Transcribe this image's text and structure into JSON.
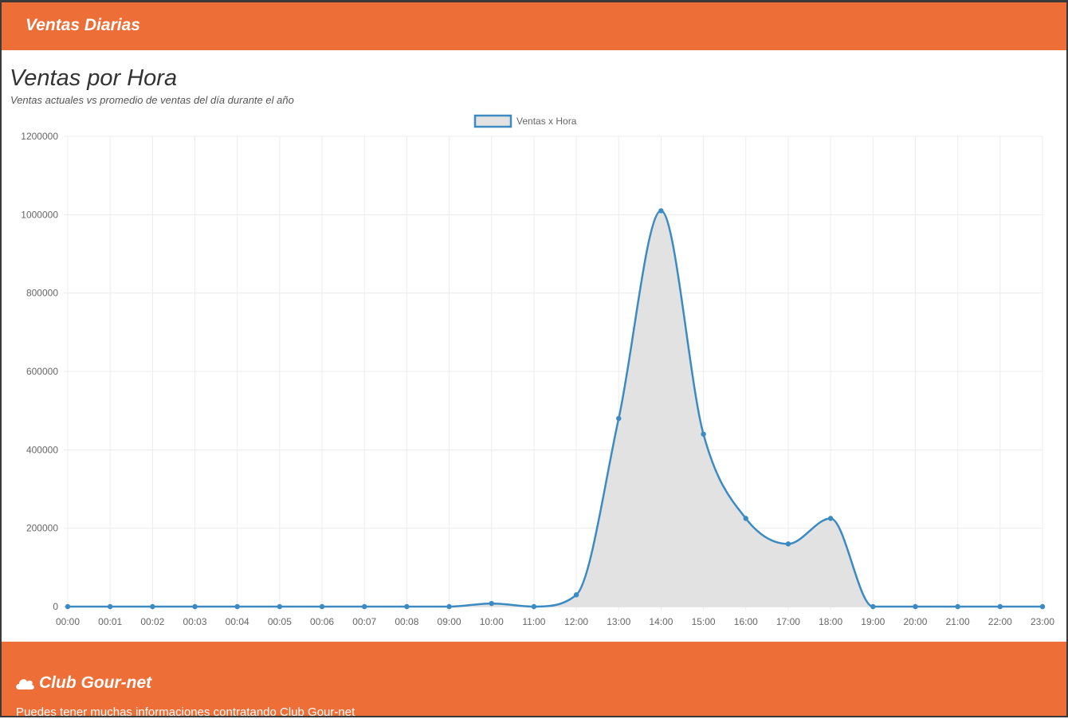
{
  "header": {
    "title": "Ventas Diarias"
  },
  "panel": {
    "title": "Ventas por Hora",
    "subtitle": "Ventas actuales vs promedio de ventas del día durante el año"
  },
  "colors": {
    "accent": "#ed6e37",
    "line": "#3b8bc2",
    "fill": "#e2e2e2",
    "grid": "#ececec"
  },
  "chart_data": {
    "type": "area",
    "title": "",
    "xlabel": "",
    "ylabel": "",
    "legend": {
      "position": "top-center",
      "entries": [
        "Ventas x Hora"
      ]
    },
    "grid": true,
    "ylim": [
      0,
      1200000
    ],
    "yticks": [
      0,
      200000,
      400000,
      600000,
      800000,
      1000000,
      1200000
    ],
    "categories": [
      "00:00",
      "00:01",
      "00:02",
      "00:03",
      "00:04",
      "00:05",
      "00:06",
      "00:07",
      "00:08",
      "09:00",
      "10:00",
      "11:00",
      "12:00",
      "13:00",
      "14:00",
      "15:00",
      "16:00",
      "17:00",
      "18:00",
      "19:00",
      "20:00",
      "21:00",
      "22:00",
      "23:00"
    ],
    "series": [
      {
        "name": "Ventas x Hora",
        "values": [
          0,
          0,
          0,
          0,
          0,
          0,
          0,
          0,
          0,
          0,
          8000,
          0,
          30000,
          480000,
          1010000,
          440000,
          225000,
          160000,
          225000,
          0,
          0,
          0,
          0,
          0
        ]
      }
    ]
  },
  "footer": {
    "brand": "Club Gour-net",
    "icon": "cloud-icon",
    "note": "Puedes tener muchas informaciones contratando Club Gour-net"
  }
}
